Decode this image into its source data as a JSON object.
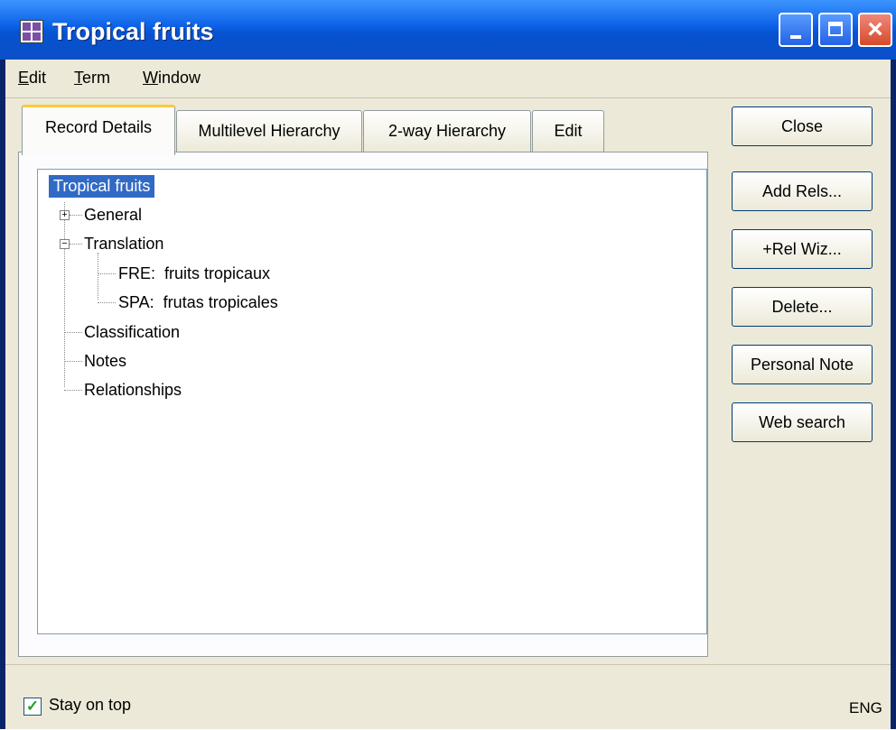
{
  "window": {
    "title": "Tropical fruits",
    "controls": {
      "minimize": "minimize",
      "maximize": "maximize",
      "close": "close"
    }
  },
  "menu": [
    {
      "label": "Edit",
      "mnemonic": "E"
    },
    {
      "label": "Term",
      "mnemonic": "T"
    },
    {
      "label": "Window",
      "mnemonic": "W"
    }
  ],
  "tabs": [
    {
      "label": "Record Details",
      "active": true
    },
    {
      "label": "Multilevel Hierarchy",
      "active": false
    },
    {
      "label": "2-way Hierarchy",
      "active": false
    },
    {
      "label": "Edit",
      "active": false
    }
  ],
  "tree": {
    "root": "Tropical fruits",
    "nodes": [
      {
        "label": "General",
        "expander": "+"
      },
      {
        "label": "Translation",
        "expander": "−",
        "children": [
          "FRE:  fruits tropicaux",
          "SPA:  frutas tropicales"
        ]
      },
      {
        "label": "Classification"
      },
      {
        "label": "Notes"
      },
      {
        "label": "Relationships"
      }
    ]
  },
  "buttons": {
    "close": "Close",
    "add_rels": "Add Rels...",
    "rel_wiz": "+Rel Wiz...",
    "delete": "Delete...",
    "personal_note": "Personal Note",
    "web_search": "Web search"
  },
  "status": {
    "stay_on_top_label": "Stay on top",
    "stay_on_top_checked": true,
    "language": "ENG"
  },
  "colors": {
    "title_bar": "#0a5fe6",
    "selection": "#316ac5",
    "tab_highlight": "#ffc83c",
    "close_button": "#d64a2a"
  }
}
